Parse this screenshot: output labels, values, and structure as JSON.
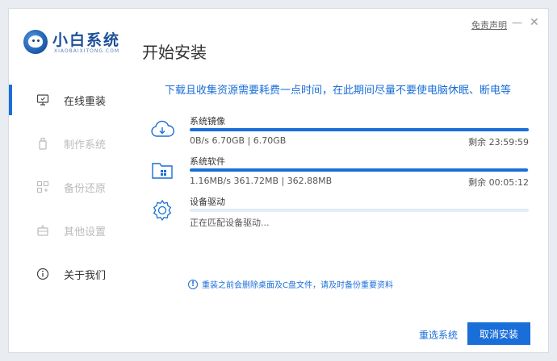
{
  "header": {
    "brand_name": "小白系统",
    "brand_sub": "XIAOBAIXITONG.COM",
    "page_title": "开始安装",
    "disclaimer": "免责声明",
    "min_symbol": "—",
    "close_symbol": "✕"
  },
  "sidebar": {
    "items": [
      {
        "label": "在线重装",
        "icon": "monitor-icon",
        "active": true
      },
      {
        "label": "制作系统",
        "icon": "usb-icon",
        "active": false
      },
      {
        "label": "备份还原",
        "icon": "backup-icon",
        "active": false
      },
      {
        "label": "其他设置",
        "icon": "settings-box-icon",
        "active": false
      },
      {
        "label": "关于我们",
        "icon": "info-icon",
        "active": false
      }
    ]
  },
  "main": {
    "notice": "下载且收集资源需要耗费一点时间，在此期间尽量不要使电脑休眠、断电等",
    "tasks": [
      {
        "name": "系统镜像",
        "icon": "cloud-download-icon",
        "stats": "0B/s 6.70GB | 6.70GB",
        "remaining": "剩余 23:59:59",
        "progress": 1.0
      },
      {
        "name": "系统软件",
        "icon": "software-folder-icon",
        "stats": "1.16MB/s 361.72MB | 362.88MB",
        "remaining": "剩余 00:05:12",
        "progress": 0.997
      },
      {
        "name": "设备驱动",
        "icon": "gear-icon",
        "stats": "正在匹配设备驱动...",
        "remaining": "",
        "progress": 0.0
      }
    ],
    "warning": "重装之前会删除桌面及C盘文件，请及时备份重要资料",
    "warning_icon_glyph": "!"
  },
  "footer": {
    "reselect_label": "重选系统",
    "cancel_label": "取消安装"
  },
  "colors": {
    "accent": "#1a6ed8",
    "brand": "#1d4f9a"
  }
}
